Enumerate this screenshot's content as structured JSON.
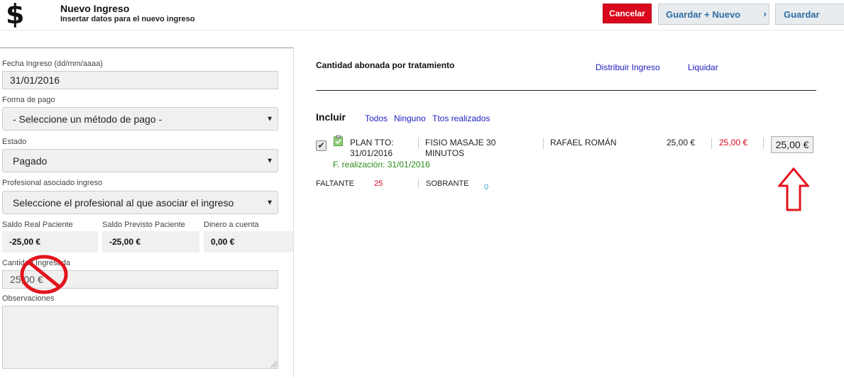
{
  "header": {
    "icon": "dollar-icon",
    "title": "Nuevo Ingreso",
    "subtitle": "Insertar datos para el nuevo ingreso",
    "cancel_label": "Cancelar",
    "save_new_label": "Guardar + Nuevo",
    "save_label": "Guardar",
    "cancel_color": "#d9061c"
  },
  "form": {
    "fecha_label": "Fecha Ingreso (dd/mm/aaaa)",
    "fecha_value": "31/01/2016",
    "forma_pago_label": "Forma de pago",
    "forma_pago_value": "- Seleccione un método de pago -",
    "estado_label": "Estado",
    "estado_value": "Pagado",
    "profesional_label": "Profesional asociado ingreso",
    "profesional_value": "Seleccione el profesional al que asociar el ingreso",
    "saldo_real_label": "Saldo Real Paciente",
    "saldo_real_value": "-25,00 €",
    "saldo_previsto_label": "Saldo Previsto Paciente",
    "saldo_previsto_value": "-25,00 €",
    "dinero_cuenta_label": "Dinero a cuenta",
    "dinero_cuenta_value": "0,00 €",
    "cantidad_label": "Cantidad Ingresada",
    "cantidad_value": "25,00 €",
    "observaciones_label": "Observaciones"
  },
  "treatment": {
    "heading": "Cantidad abonada por tratamiento",
    "distribuir_link": "Distribuir Ingreso",
    "liquidar_link": "Liquidar",
    "incluir_label": "Incluir",
    "todos_link": "Todos",
    "ninguno_link": "Ninguno",
    "ttos_link": "Ttos realizados",
    "row": {
      "checked": true,
      "plan_line1": "PLAN TTO:",
      "plan_line2": "31/01/2016",
      "servicio_line1": "FISIO MASAJE 30",
      "servicio_line2": "MINUTOS",
      "profesional": "RAFAEL ROMÁN",
      "precio": "25,00 €",
      "pendiente": "25,00 €",
      "abonado": "25,00 €",
      "realizacion": "F. realización: 31/01/2016"
    },
    "faltante_label": "FALTANTE",
    "faltante_value": "25",
    "sobrante_label": "SOBRANTE",
    "sobrante_value": "0"
  }
}
